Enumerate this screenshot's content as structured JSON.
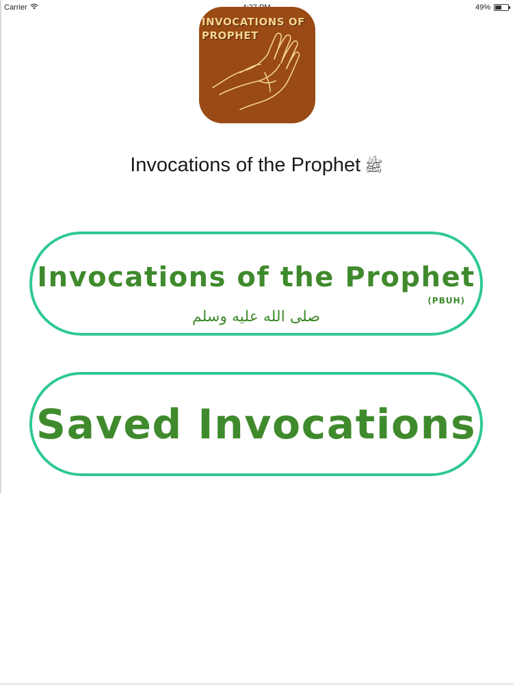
{
  "status_bar": {
    "carrier": "Carrier",
    "time": "4:27 PM",
    "battery": "49%",
    "battery_level": 0.49
  },
  "app_icon": {
    "line1": "INVOCATIONS OF",
    "line2": "PROPHET",
    "icon": "praying-hands-icon",
    "background_color": "#9a4a14"
  },
  "header": {
    "title": "Invocations of the Prophet",
    "honorific_glyph": "ﷺ"
  },
  "buttons": {
    "invocations": {
      "label": "Invocations of the Prophet",
      "pbuh": "(PBUH)",
      "arabic": "صلى الله عليه وسلم"
    },
    "saved": {
      "label": "Saved Invocations"
    }
  },
  "colors": {
    "button_border": "#2ec990",
    "button_text": "#3f8a2c"
  }
}
